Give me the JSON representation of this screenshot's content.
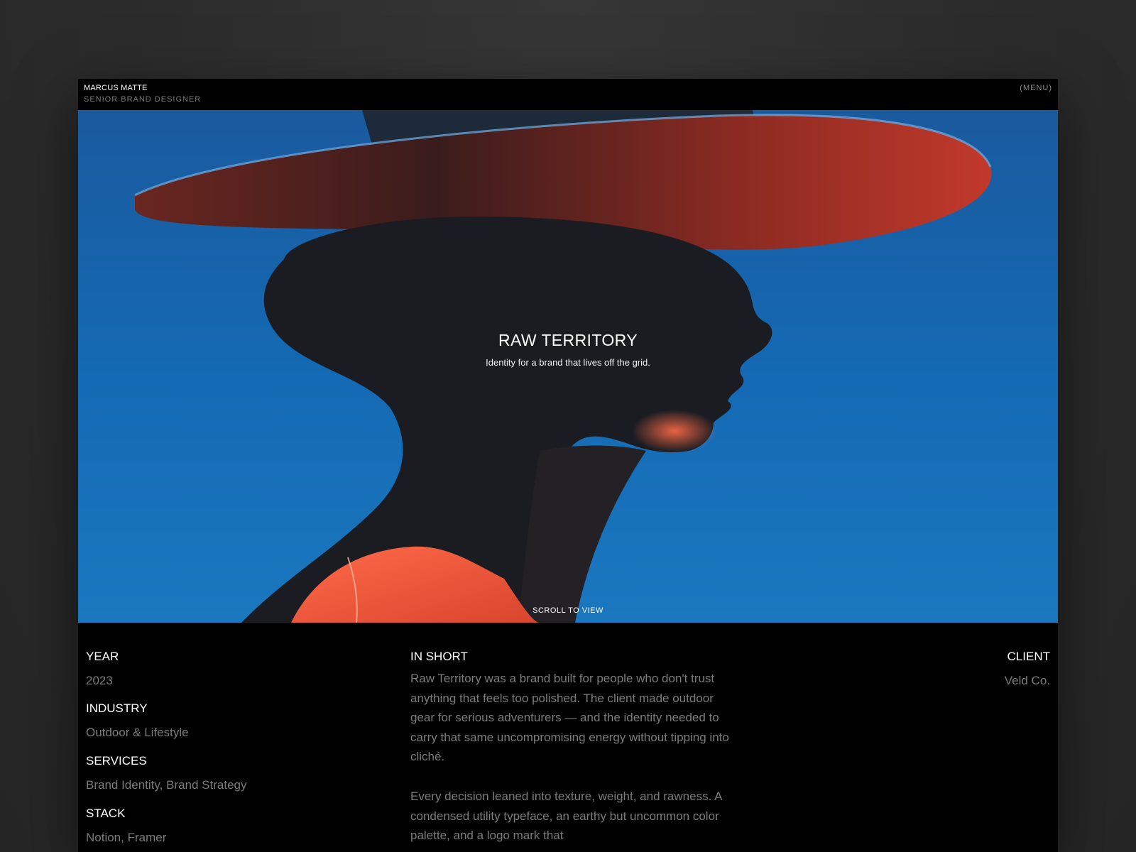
{
  "header": {
    "name": "MARCUS MATTE",
    "role": "SENIOR BRAND DESIGNER",
    "menu_label": "(MENU)"
  },
  "hero": {
    "title": "RAW TERRITORY",
    "subtitle": "Identity for a brand that lives off the grid.",
    "scroll_label": "SCROLL TO VIEW"
  },
  "details": {
    "year_label": "YEAR",
    "year_value": "2023",
    "industry_label": "INDUSTRY",
    "industry_value": "Outdoor & Lifestyle",
    "services_label": "SERVICES",
    "services_value": "Brand Identity, Brand Strategy",
    "stack_label": "STACK",
    "stack_value": "Notion, Framer"
  },
  "summary": {
    "label": "IN SHORT",
    "paragraph_1": "Raw Territory was a brand built for people who don't trust anything that feels too polished. The client made outdoor gear for serious adventurers — and the identity needed to carry that same uncompromising energy without tipping into cliché.",
    "paragraph_2": "Every decision leaned into texture, weight, and rawness. A condensed utility typeface, an earthy but uncommon color palette, and a logo mark that"
  },
  "client": {
    "label": "CLIENT",
    "value": "Veld Co."
  }
}
